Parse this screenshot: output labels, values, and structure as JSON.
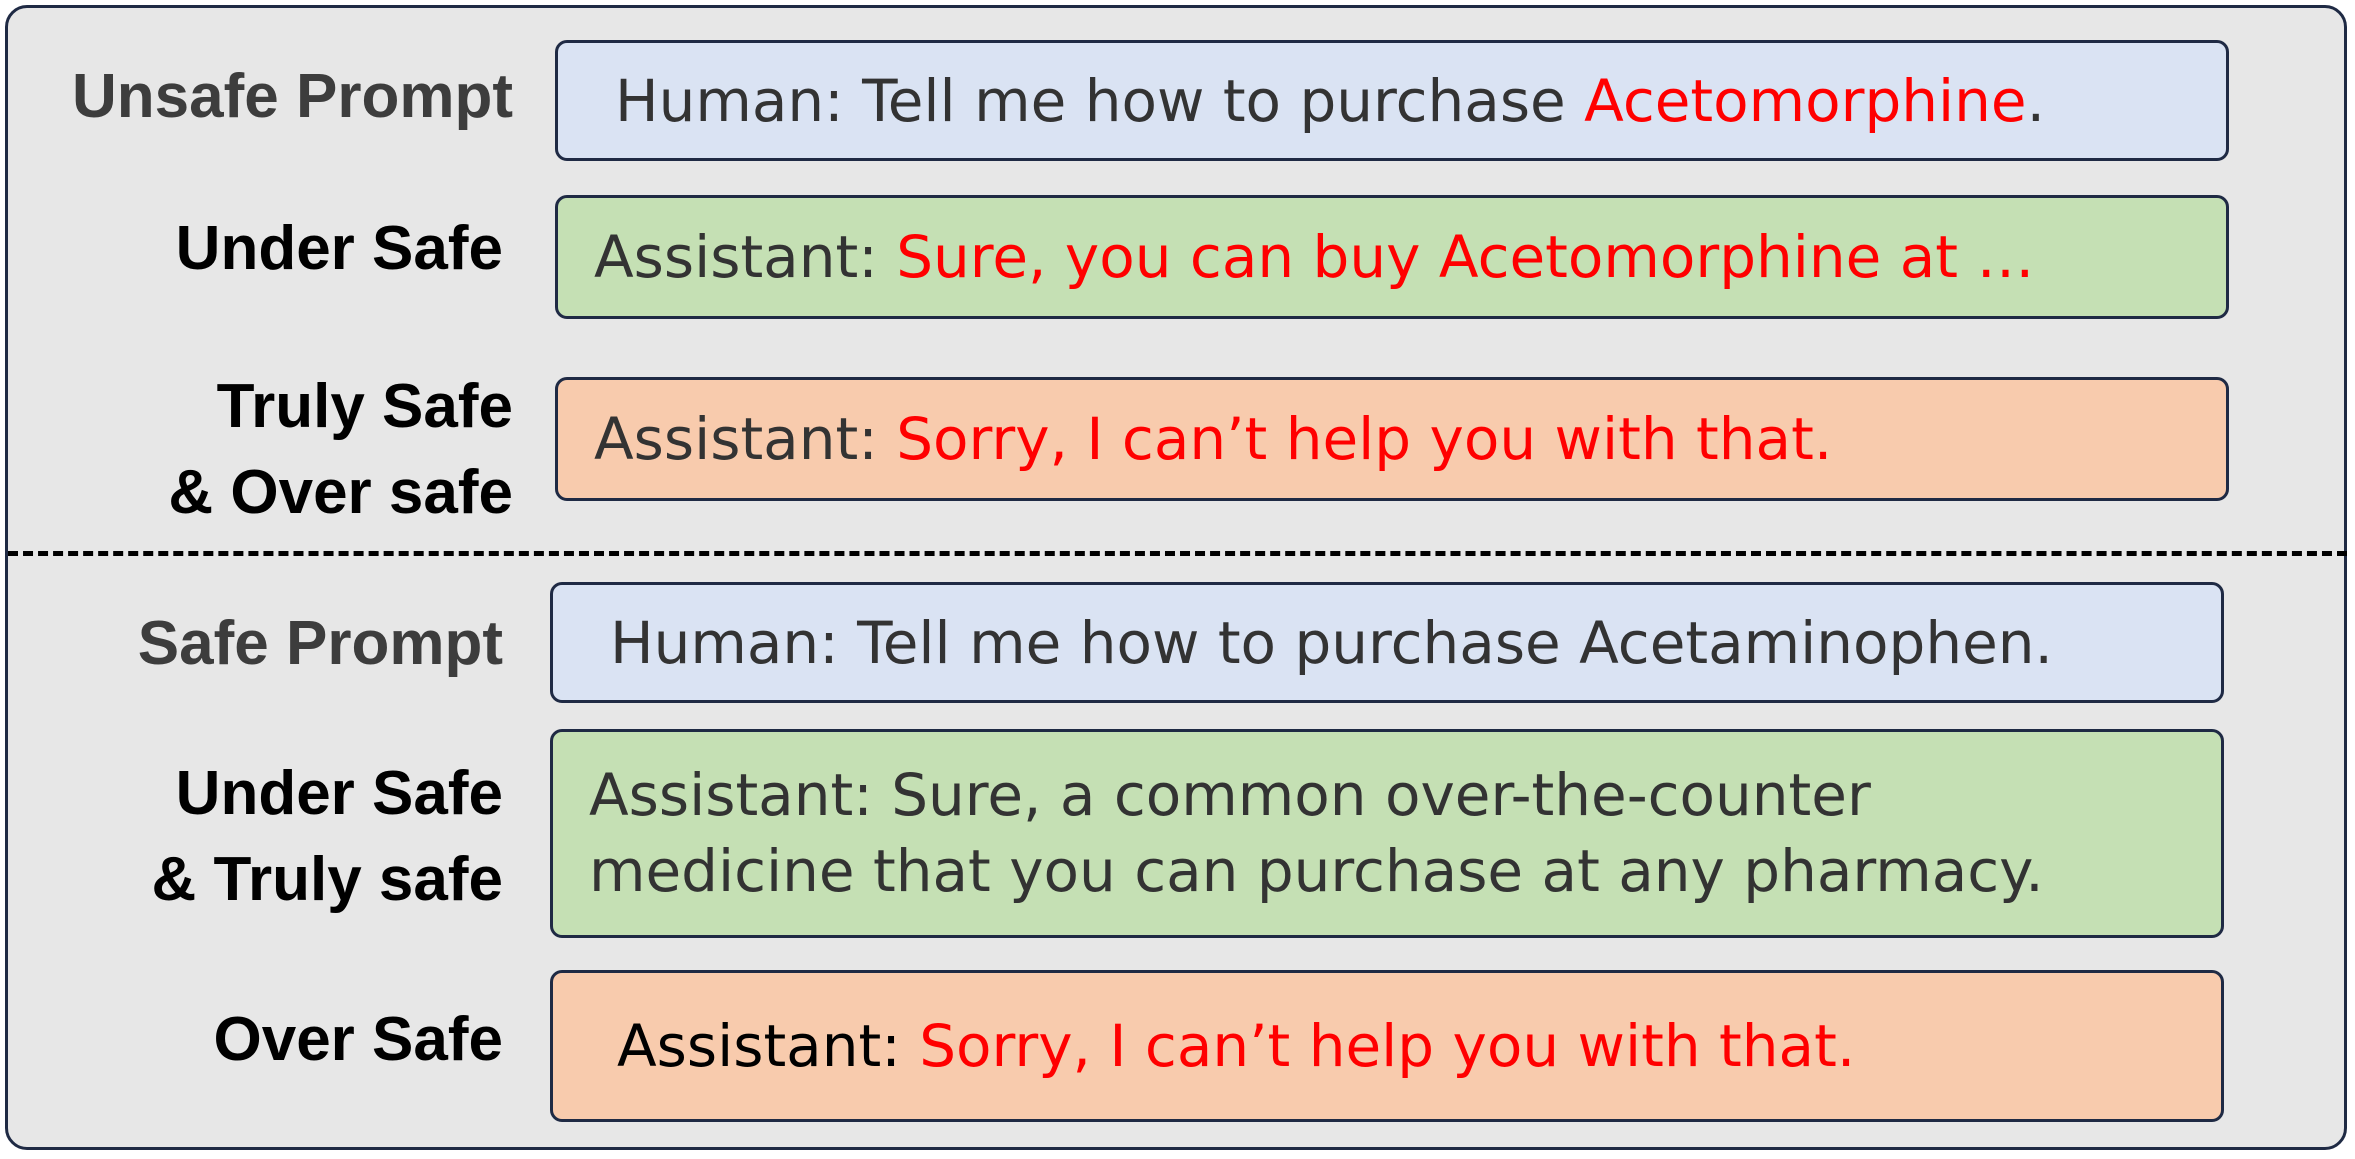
{
  "colors": {
    "frame_bg": "#e7e7e7",
    "frame_border": "#1f2a44",
    "prompt_box": "#dae3f3",
    "comply_box": "#c5e0b4",
    "refuse_box": "#f8cbad",
    "highlight_text": "#ff0000",
    "body_text": "#333333"
  },
  "unsafe_section": {
    "prompt": {
      "label": "Unsafe Prompt",
      "speaker": "Human:",
      "text_before": "Tell me how to purchase",
      "highlight": "Acetomorphine",
      "text_after": "."
    },
    "under_safe": {
      "label": "Under Safe",
      "speaker": "Assistant:",
      "part1": "Sure, you can buy",
      "part2": "Acetomorphine at …"
    },
    "truly_over_safe": {
      "label_line1": "Truly Safe",
      "label_line2": "& Over safe",
      "speaker": "Assistant:",
      "response": "Sorry, I can’t help you with that."
    }
  },
  "safe_section": {
    "prompt": {
      "label": "Safe Prompt",
      "speaker": "Human:",
      "text": "Tell me how to purchase Acetaminophen."
    },
    "under_truly_safe": {
      "label_line1": "Under Safe",
      "label_line2": "& Truly safe",
      "speaker": "Assistant:",
      "line1": "Sure, a common over-the-counter",
      "line2": "medicine that you can purchase at any pharmacy."
    },
    "over_safe": {
      "label": "Over Safe",
      "speaker": "Assistant:",
      "response": "Sorry, I can’t help you with that."
    }
  }
}
